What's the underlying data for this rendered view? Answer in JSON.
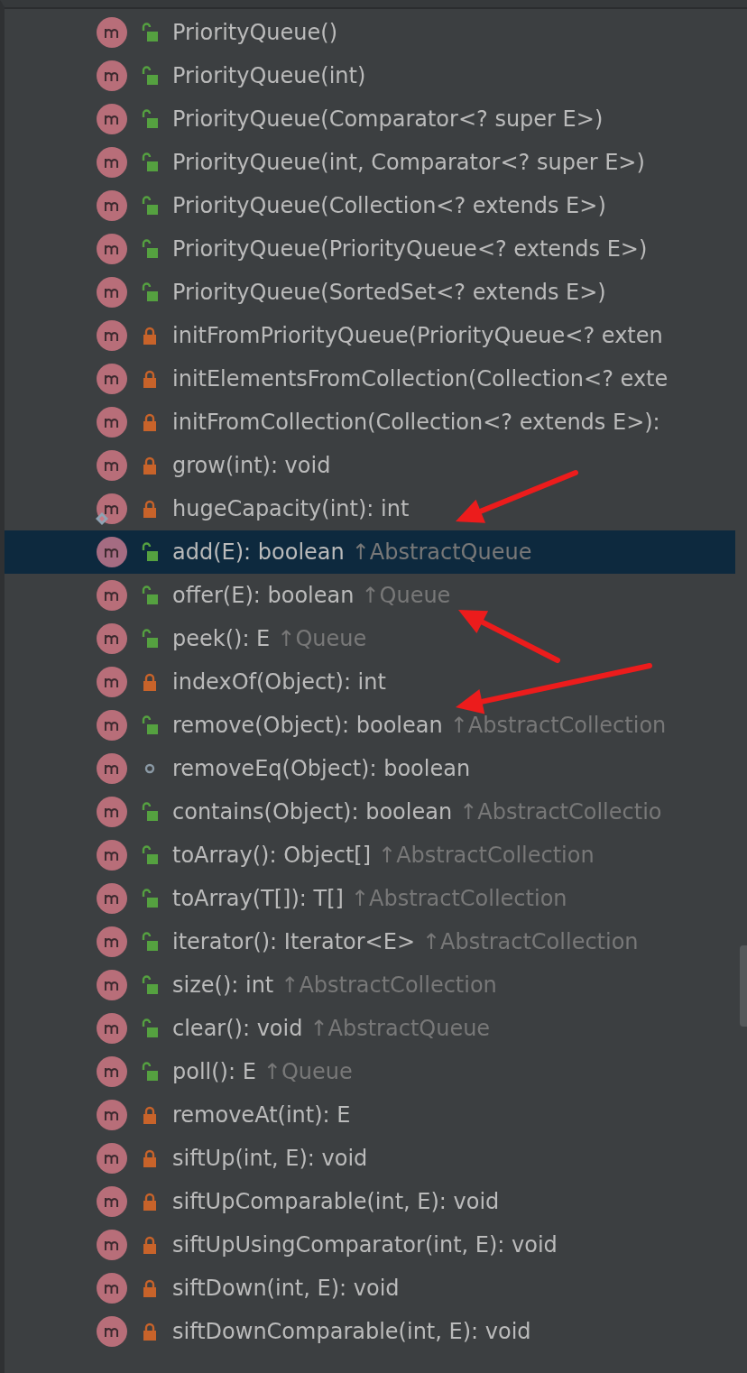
{
  "members": [
    {
      "name": "PriorityQueue()",
      "kind": "public",
      "selected": false
    },
    {
      "name": "PriorityQueue(int)",
      "kind": "public",
      "selected": false
    },
    {
      "name": "PriorityQueue(Comparator<? super E>)",
      "kind": "public",
      "selected": false
    },
    {
      "name": "PriorityQueue(int, Comparator<? super E>)",
      "kind": "public",
      "selected": false
    },
    {
      "name": "PriorityQueue(Collection<? extends E>)",
      "kind": "public",
      "selected": false
    },
    {
      "name": "PriorityQueue(PriorityQueue<? extends E>)",
      "kind": "public",
      "selected": false
    },
    {
      "name": "PriorityQueue(SortedSet<? extends E>)",
      "kind": "public",
      "selected": false
    },
    {
      "name": "initFromPriorityQueue(PriorityQueue<? exten",
      "kind": "private",
      "selected": false
    },
    {
      "name": "initElementsFromCollection(Collection<? exte",
      "kind": "private",
      "selected": false
    },
    {
      "name": "initFromCollection(Collection<? extends E>):",
      "kind": "private",
      "selected": false
    },
    {
      "name": "grow(int): void",
      "kind": "private",
      "selected": false
    },
    {
      "name": "hugeCapacity(int): int",
      "kind": "private",
      "selected": false,
      "marker": true,
      "arrow": true
    },
    {
      "name": "add(E): boolean",
      "inherited": "↑AbstractQueue",
      "kind": "public",
      "selected": true
    },
    {
      "name": "offer(E): boolean",
      "inherited": "↑Queue",
      "kind": "public",
      "selected": false,
      "arrow": true
    },
    {
      "name": "peek(): E",
      "inherited": "↑Queue",
      "kind": "public",
      "selected": false
    },
    {
      "name": "indexOf(Object): int",
      "kind": "private",
      "selected": false
    },
    {
      "name": "remove(Object): boolean",
      "inherited": "↑AbstractCollection",
      "kind": "public",
      "selected": false,
      "arrow": true
    },
    {
      "name": "removeEq(Object): boolean",
      "kind": "package",
      "selected": false
    },
    {
      "name": "contains(Object): boolean",
      "inherited": "↑AbstractCollectio",
      "kind": "public",
      "selected": false
    },
    {
      "name": "toArray(): Object[]",
      "inherited": "↑AbstractCollection",
      "kind": "public",
      "selected": false
    },
    {
      "name": "toArray(T[]): T[]",
      "inherited": "↑AbstractCollection",
      "kind": "public",
      "selected": false
    },
    {
      "name": "iterator(): Iterator<E>",
      "inherited": "↑AbstractCollection",
      "kind": "public",
      "selected": false
    },
    {
      "name": "size(): int",
      "inherited": "↑AbstractCollection",
      "kind": "public",
      "selected": false
    },
    {
      "name": "clear(): void",
      "inherited": "↑AbstractQueue",
      "kind": "public",
      "selected": false
    },
    {
      "name": "poll(): E",
      "inherited": "↑Queue",
      "kind": "public",
      "selected": false
    },
    {
      "name": "removeAt(int): E",
      "kind": "private",
      "selected": false
    },
    {
      "name": "siftUp(int, E): void",
      "kind": "private",
      "selected": false
    },
    {
      "name": "siftUpComparable(int, E): void",
      "kind": "private",
      "selected": false
    },
    {
      "name": "siftUpUsingComparator(int, E): void",
      "kind": "private",
      "selected": false
    },
    {
      "name": "siftDown(int, E): void",
      "kind": "private",
      "selected": false
    },
    {
      "name": "siftDownComparable(int, E): void",
      "kind": "private",
      "selected": false
    }
  ]
}
